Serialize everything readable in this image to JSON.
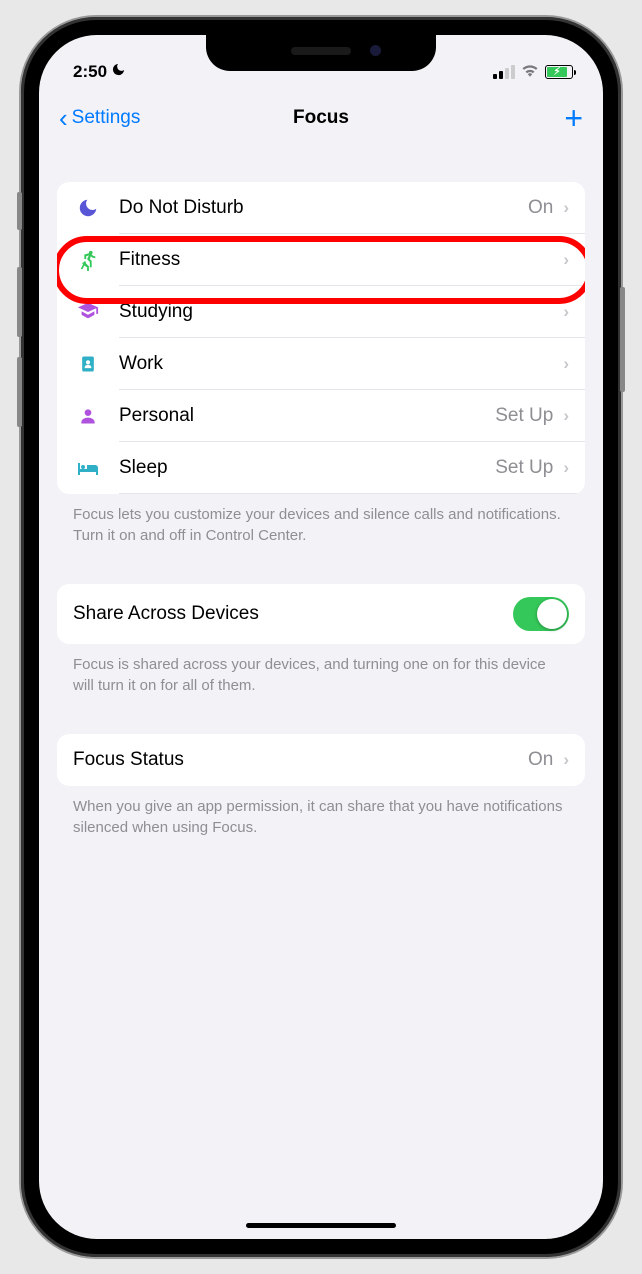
{
  "status_bar": {
    "time": "2:50"
  },
  "nav": {
    "back_label": "Settings",
    "title": "Focus"
  },
  "focus_modes": [
    {
      "label": "Do Not Disturb",
      "detail": "On"
    },
    {
      "label": "Fitness",
      "detail": ""
    },
    {
      "label": "Studying",
      "detail": ""
    },
    {
      "label": "Work",
      "detail": ""
    },
    {
      "label": "Personal",
      "detail": "Set Up"
    },
    {
      "label": "Sleep",
      "detail": "Set Up"
    }
  ],
  "footer_modes": "Focus lets you customize your devices and silence calls and notifications. Turn it on and off in Control Center.",
  "share": {
    "label": "Share Across Devices",
    "enabled": true
  },
  "footer_share": "Focus is shared across your devices, and turning one on for this device will turn it on for all of them.",
  "focus_status": {
    "label": "Focus Status",
    "detail": "On"
  },
  "footer_status": "When you give an app permission, it can share that you have notifications silenced when using Focus.",
  "highlighted_index": 1
}
